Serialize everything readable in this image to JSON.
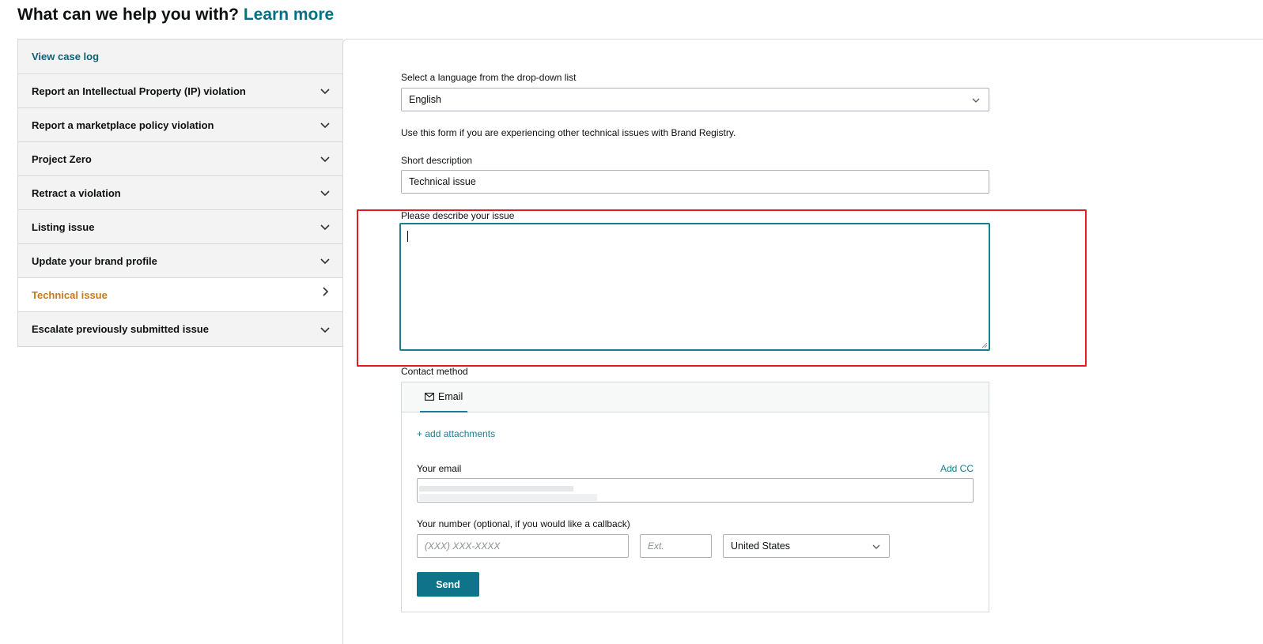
{
  "header": {
    "title": "What can we help you with?",
    "learn_more": "Learn more"
  },
  "sidebar": {
    "items": [
      {
        "label": "View case log",
        "chevron": "none"
      },
      {
        "label": "Report an Intellectual Property (IP) violation",
        "chevron": "down"
      },
      {
        "label": "Report a marketplace policy violation",
        "chevron": "down"
      },
      {
        "label": "Project Zero",
        "chevron": "down"
      },
      {
        "label": "Retract a violation",
        "chevron": "down"
      },
      {
        "label": "Listing issue",
        "chevron": "down"
      },
      {
        "label": "Update your brand profile",
        "chevron": "down"
      },
      {
        "label": "Technical issue",
        "chevron": "right",
        "active": true
      },
      {
        "label": "Escalate previously submitted issue",
        "chevron": "down"
      }
    ]
  },
  "form": {
    "language_label": "Select a language from the drop-down list",
    "language_value": "English",
    "intro_text": "Use this form if you are experiencing other technical issues with Brand Registry.",
    "short_desc_label": "Short description",
    "short_desc_value": "Technical issue",
    "describe_label": "Please describe your issue",
    "describe_value": ""
  },
  "contact": {
    "label": "Contact method",
    "tab_email": "Email",
    "add_attachments": "+ add attachments",
    "your_email_label": "Your email",
    "add_cc": "Add CC",
    "number_label": "Your number (optional, if you would like a callback)",
    "phone_placeholder": "(XXX) XXX-XXXX",
    "ext_placeholder": "Ext.",
    "country_value": "United States",
    "send_label": "Send"
  },
  "colors": {
    "accent": "#007185",
    "active_item": "#c7791a",
    "highlight": "#e31b23",
    "send_button": "#0f7389"
  }
}
